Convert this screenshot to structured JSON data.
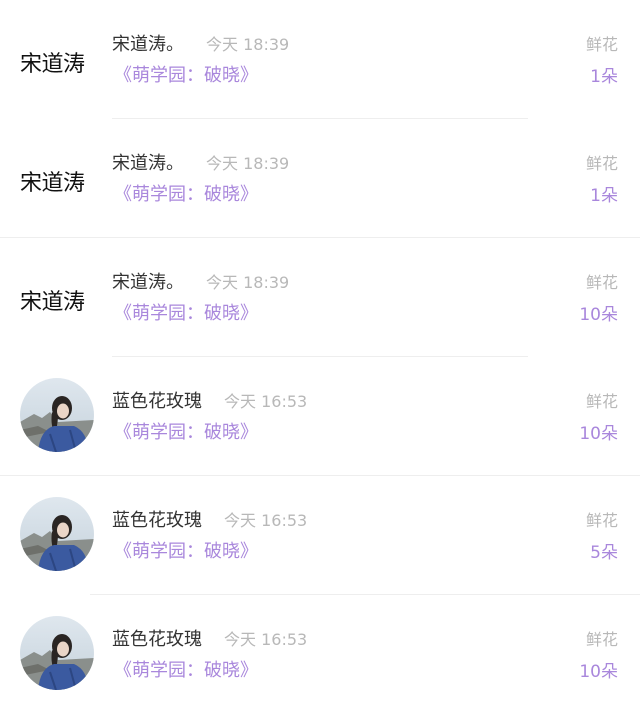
{
  "gift_records": [
    {
      "avatar_type": "text",
      "avatar_text": "宋道涛",
      "name": "宋道涛。",
      "time": "今天 18:39",
      "book": "《萌学园：破晓》",
      "gift_type": "鲜花",
      "gift_count": "1朵"
    },
    {
      "avatar_type": "text",
      "avatar_text": "宋道涛",
      "name": "宋道涛。",
      "time": "今天 18:39",
      "book": "《萌学园：破晓》",
      "gift_type": "鲜花",
      "gift_count": "1朵"
    },
    {
      "avatar_type": "text",
      "avatar_text": "宋道涛",
      "name": "宋道涛。",
      "time": "今天 18:39",
      "book": "《萌学园：破晓》",
      "gift_type": "鲜花",
      "gift_count": "10朵"
    },
    {
      "avatar_type": "photo",
      "avatar_text": "",
      "name": "蓝色花玫瑰",
      "time": "今天 16:53",
      "book": "《萌学园：破晓》",
      "gift_type": "鲜花",
      "gift_count": "10朵"
    },
    {
      "avatar_type": "photo",
      "avatar_text": "",
      "name": "蓝色花玫瑰",
      "time": "今天 16:53",
      "book": "《萌学园：破晓》",
      "gift_type": "鲜花",
      "gift_count": "5朵"
    },
    {
      "avatar_type": "photo",
      "avatar_text": "",
      "name": "蓝色花玫瑰",
      "time": "今天 16:53",
      "book": "《萌学园：破晓》",
      "gift_type": "鲜花",
      "gift_count": "10朵"
    }
  ],
  "colors": {
    "name": "#333333",
    "meta": "#b8b8b8",
    "accent": "#a987dc",
    "divider": "#eeeeee"
  }
}
